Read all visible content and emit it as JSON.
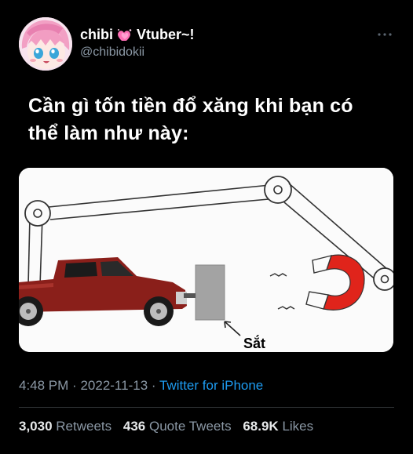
{
  "user": {
    "display_name": "chibi",
    "name_suffix": "Vtuber~!",
    "heart_icon": "sparkling-heart-icon",
    "handle": "@chibidokii"
  },
  "tweet": {
    "text": "Cần gì tốn tiền đổ xăng khi bạn có thể làm như này:",
    "image_caption": "Sắt"
  },
  "meta": {
    "time": "4:48 PM",
    "separator": "·",
    "date": "2022-11-13",
    "source": "Twitter for iPhone"
  },
  "stats": {
    "retweets_count": "3,030",
    "retweets_label": "Retweets",
    "quotes_count": "436",
    "quotes_label": "Quote Tweets",
    "likes_count": "68.9K",
    "likes_label": "Likes"
  },
  "colors": {
    "background": "#000000",
    "link": "#1d9bf0",
    "muted": "#8b98a5",
    "truck_red": "#8a1f1a",
    "magnet_red": "#e0241b"
  }
}
